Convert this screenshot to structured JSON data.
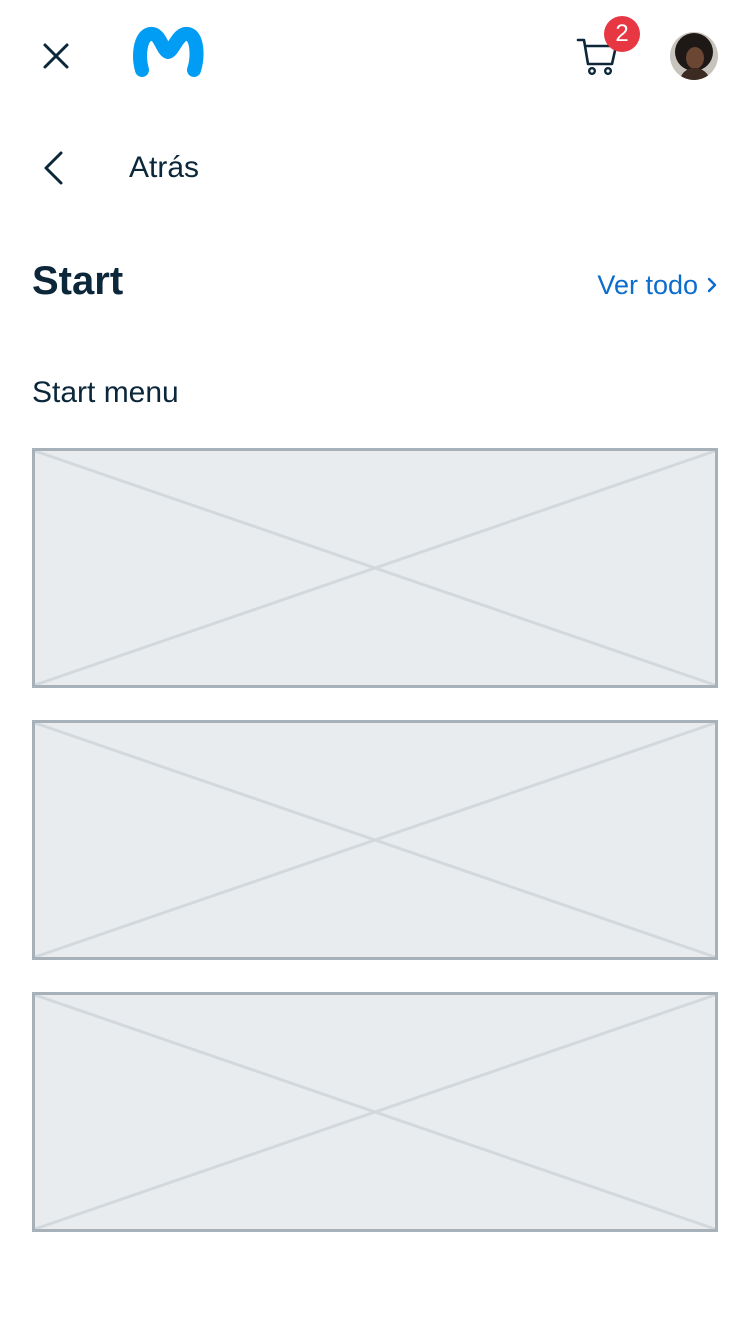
{
  "header": {
    "close_icon": "close-icon",
    "logo_icon": "movistar-logo",
    "cart_icon": "cart-icon",
    "cart_count": "2",
    "avatar_icon": "user-avatar"
  },
  "nav": {
    "back_icon": "chevron-left-icon",
    "back_label": "Atrás"
  },
  "section": {
    "title": "Start",
    "see_all_label": "Ver todo",
    "subtitle": "Start menu"
  },
  "cards": [
    {
      "placeholder": "image-placeholder"
    },
    {
      "placeholder": "image-placeholder"
    },
    {
      "placeholder": "image-placeholder"
    }
  ],
  "colors": {
    "text": "#0b2739",
    "link": "#0b6dce",
    "brand": "#019df4",
    "badge": "#e63743",
    "placeholder_bg": "#e8ecee",
    "placeholder_border": "#a6b1ba"
  }
}
